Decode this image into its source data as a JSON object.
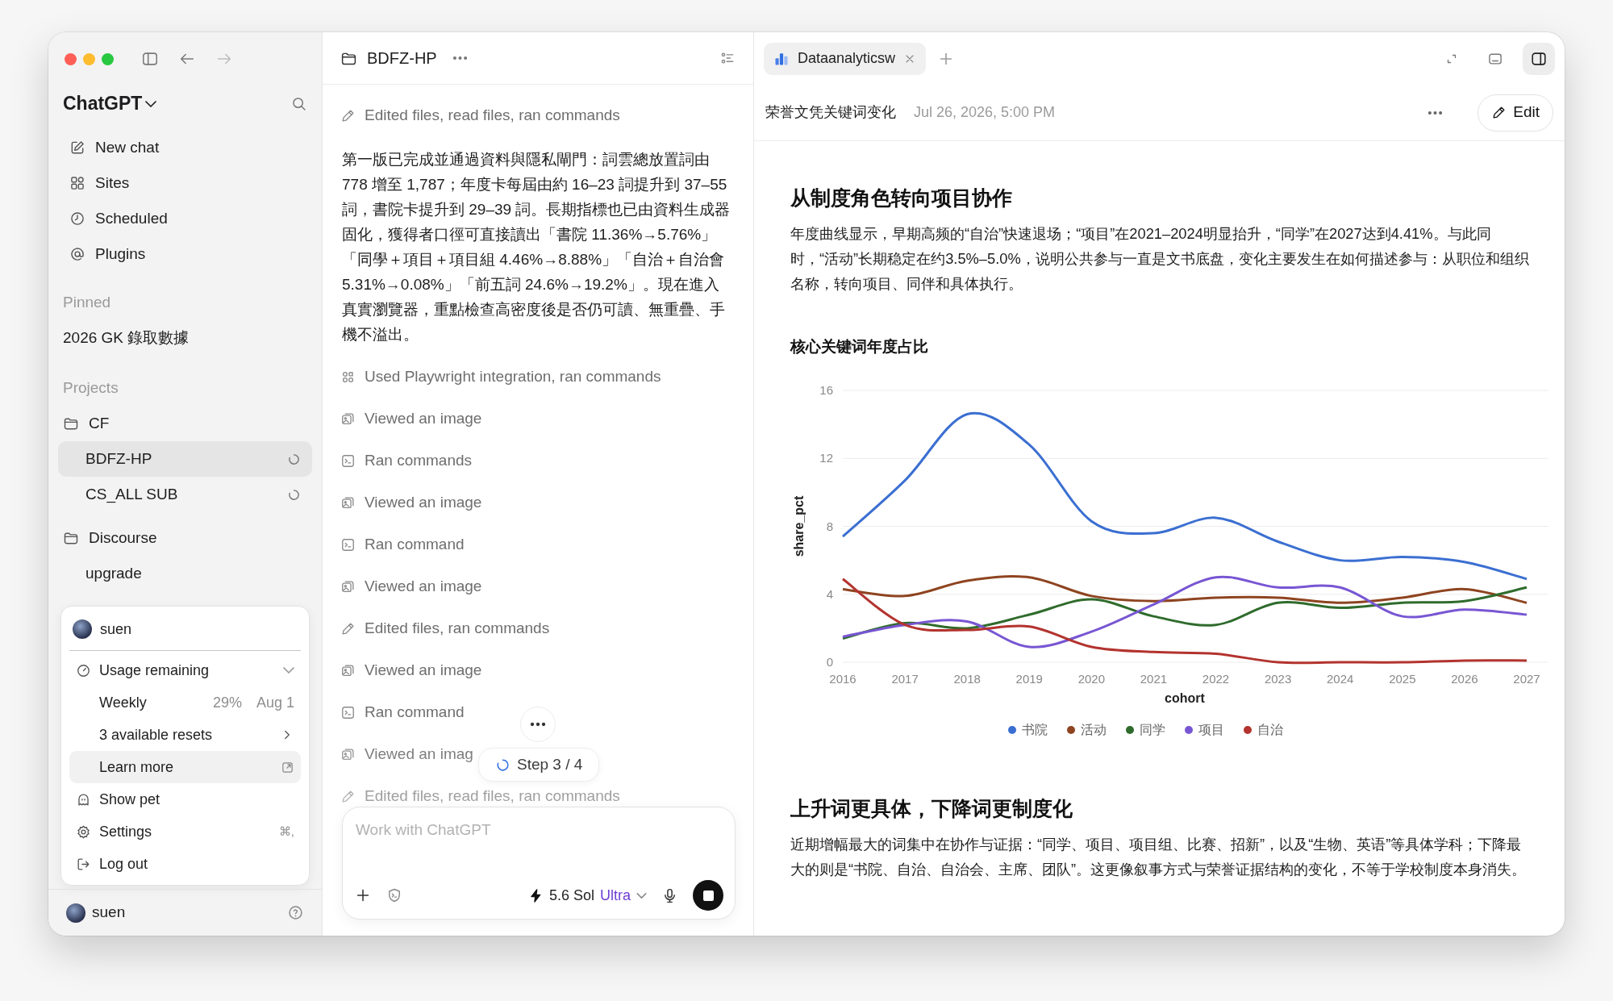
{
  "sidebar": {
    "title": "ChatGPT",
    "nav": [
      "New chat",
      "Sites",
      "Scheduled",
      "Plugins"
    ],
    "pinned": {
      "heading": "Pinned",
      "items": [
        {
          "label": "2026 GK 錄取數據",
          "selected": false
        }
      ]
    },
    "projects": {
      "heading": "Projects",
      "folders": [
        {
          "label": "CF",
          "children": [
            {
              "label": "BDFZ-HP",
              "selected": true,
              "loading": true
            },
            {
              "label": "CS_ALL SUB",
              "selected": false,
              "loading": true
            }
          ]
        },
        {
          "label": "Discourse",
          "children": [
            {
              "label": "upgrade",
              "selected": false,
              "loading": false
            }
          ]
        }
      ]
    },
    "account_menu": {
      "user": "suen",
      "usage": {
        "label": "Usage remaining",
        "expanded": true,
        "period": "Weekly",
        "percent": "29%",
        "reset": "Aug 1",
        "resets": "3 available resets"
      },
      "items": [
        {
          "kind": "link",
          "label": "Learn more",
          "hovered": true
        },
        {
          "kind": "action",
          "label": "Show pet",
          "hovered": false
        },
        {
          "kind": "action",
          "label": "Settings",
          "shortcut": "⌘,",
          "hovered": false
        },
        {
          "kind": "action",
          "label": "Log out",
          "hovered": false
        }
      ]
    },
    "footer_user": "suen"
  },
  "thread": {
    "title": "BDFZ-HP",
    "activity": [
      {
        "kind": "edit",
        "text": "Edited files, read files, ran commands"
      },
      {
        "kind": "message",
        "text": "第一版已完成並通過資料與隱私閘門：詞雲總放置詞由 778 增至 1,787；年度卡每屆由約 16–23 詞提升到 37–55 詞，書院卡提升到 29–39 詞。長期指標也已由資料生成器固化，獲得者口徑可直接讀出「書院 11.36%→5.76%」「同學＋項目＋項目組 4.46%→8.88%」「自治＋自治會 5.31%→0.08%」「前五詞 24.6%→19.2%」。現在進入真實瀏覽器，重點檢查高密度後是否仍可讀、無重疊、手機不溢出。"
      },
      {
        "kind": "tool",
        "text": "Used Playwright integration, ran commands"
      },
      {
        "kind": "image",
        "text": "Viewed an image"
      },
      {
        "kind": "command",
        "text": "Ran commands"
      },
      {
        "kind": "image",
        "text": "Viewed an image"
      },
      {
        "kind": "command",
        "text": "Ran command"
      },
      {
        "kind": "image",
        "text": "Viewed an image"
      },
      {
        "kind": "edit",
        "text": "Edited files, ran commands"
      },
      {
        "kind": "image",
        "text": "Viewed an image"
      },
      {
        "kind": "command",
        "text": "Ran command"
      },
      {
        "kind": "image",
        "text": "Viewed an imag"
      },
      {
        "kind": "edit",
        "text": "Edited files, read files, ran commands"
      }
    ],
    "step": "Step 3 / 4",
    "composer": {
      "placeholder": "Work with ChatGPT",
      "model": "5.6 Sol",
      "tier": "Ultra",
      "running": true
    }
  },
  "viewer": {
    "tabs": [
      {
        "label": "Dataanalyticsw",
        "selected": true
      }
    ],
    "side_panel_open": true,
    "document": {
      "title": "荣誉文凭关键词变化",
      "timestamp": "Jul 26, 2026, 5:00 PM",
      "edit": "Edit"
    },
    "content": [
      {
        "kind": "heading",
        "text": "从制度角色转向项目协作"
      },
      {
        "kind": "paragraph",
        "text": "年度曲线显示，早期高频的“自治”快速退场；“项目”在2021–2024明显抬升，“同学”在2027达到4.41%。与此同时，“活动”长期稳定在约3.5%–5.0%，说明公共参与一直是文书底盘，变化主要发生在如何描述参与：从职位和组织名称，转向项目、同伴和具体执行。"
      },
      {
        "kind": "chart",
        "chart_data": {
          "type": "line",
          "title": "核心关键词年度占比",
          "xlabel": "cohort",
          "ylabel": "share_pct",
          "categories": [
            "2016",
            "2017",
            "2018",
            "2019",
            "2020",
            "2021",
            "2022",
            "2023",
            "2024",
            "2025",
            "2026",
            "2027"
          ],
          "ylim": [
            0,
            16
          ],
          "yticks": [
            0,
            4,
            8,
            12,
            16
          ],
          "grid": true,
          "legend": true,
          "series": [
            {
              "name": "书院",
              "color": "#3b6fd1",
              "values": [
                7.4,
                10.7,
                14.6,
                12.8,
                8.3,
                7.6,
                8.5,
                7.1,
                6.0,
                6.2,
                5.9,
                4.9
              ]
            },
            {
              "name": "活动",
              "color": "#8e4420",
              "values": [
                4.3,
                3.9,
                4.8,
                5.0,
                3.9,
                3.6,
                3.8,
                3.8,
                3.5,
                3.8,
                4.3,
                3.5
              ]
            },
            {
              "name": "同学",
              "color": "#2f6b2c",
              "values": [
                1.4,
                2.3,
                2.0,
                2.8,
                3.7,
                2.7,
                2.2,
                3.5,
                3.2,
                3.5,
                3.6,
                4.4
              ]
            },
            {
              "name": "项目",
              "color": "#7856d3",
              "values": [
                1.5,
                2.2,
                2.4,
                0.9,
                1.8,
                3.4,
                5.0,
                4.4,
                4.4,
                2.7,
                3.1,
                2.8
              ]
            },
            {
              "name": "自治",
              "color": "#b3332e",
              "values": [
                4.9,
                2.2,
                1.9,
                2.1,
                0.9,
                0.6,
                0.5,
                0.0,
                0.0,
                0.0,
                0.1,
                0.1
              ]
            }
          ]
        }
      },
      {
        "kind": "heading",
        "text": "上升词更具体，下降词更制度化"
      },
      {
        "kind": "paragraph",
        "text": "近期增幅最大的词集中在协作与证据：“同学、项目、项目组、比赛、招新”，以及“生物、英语”等具体学科；下降最大的则是“书院、自治、自治会、主席、团队”。这更像叙事方式与荣誉证据结构的变化，不等于学校制度本身消失。"
      }
    ]
  }
}
